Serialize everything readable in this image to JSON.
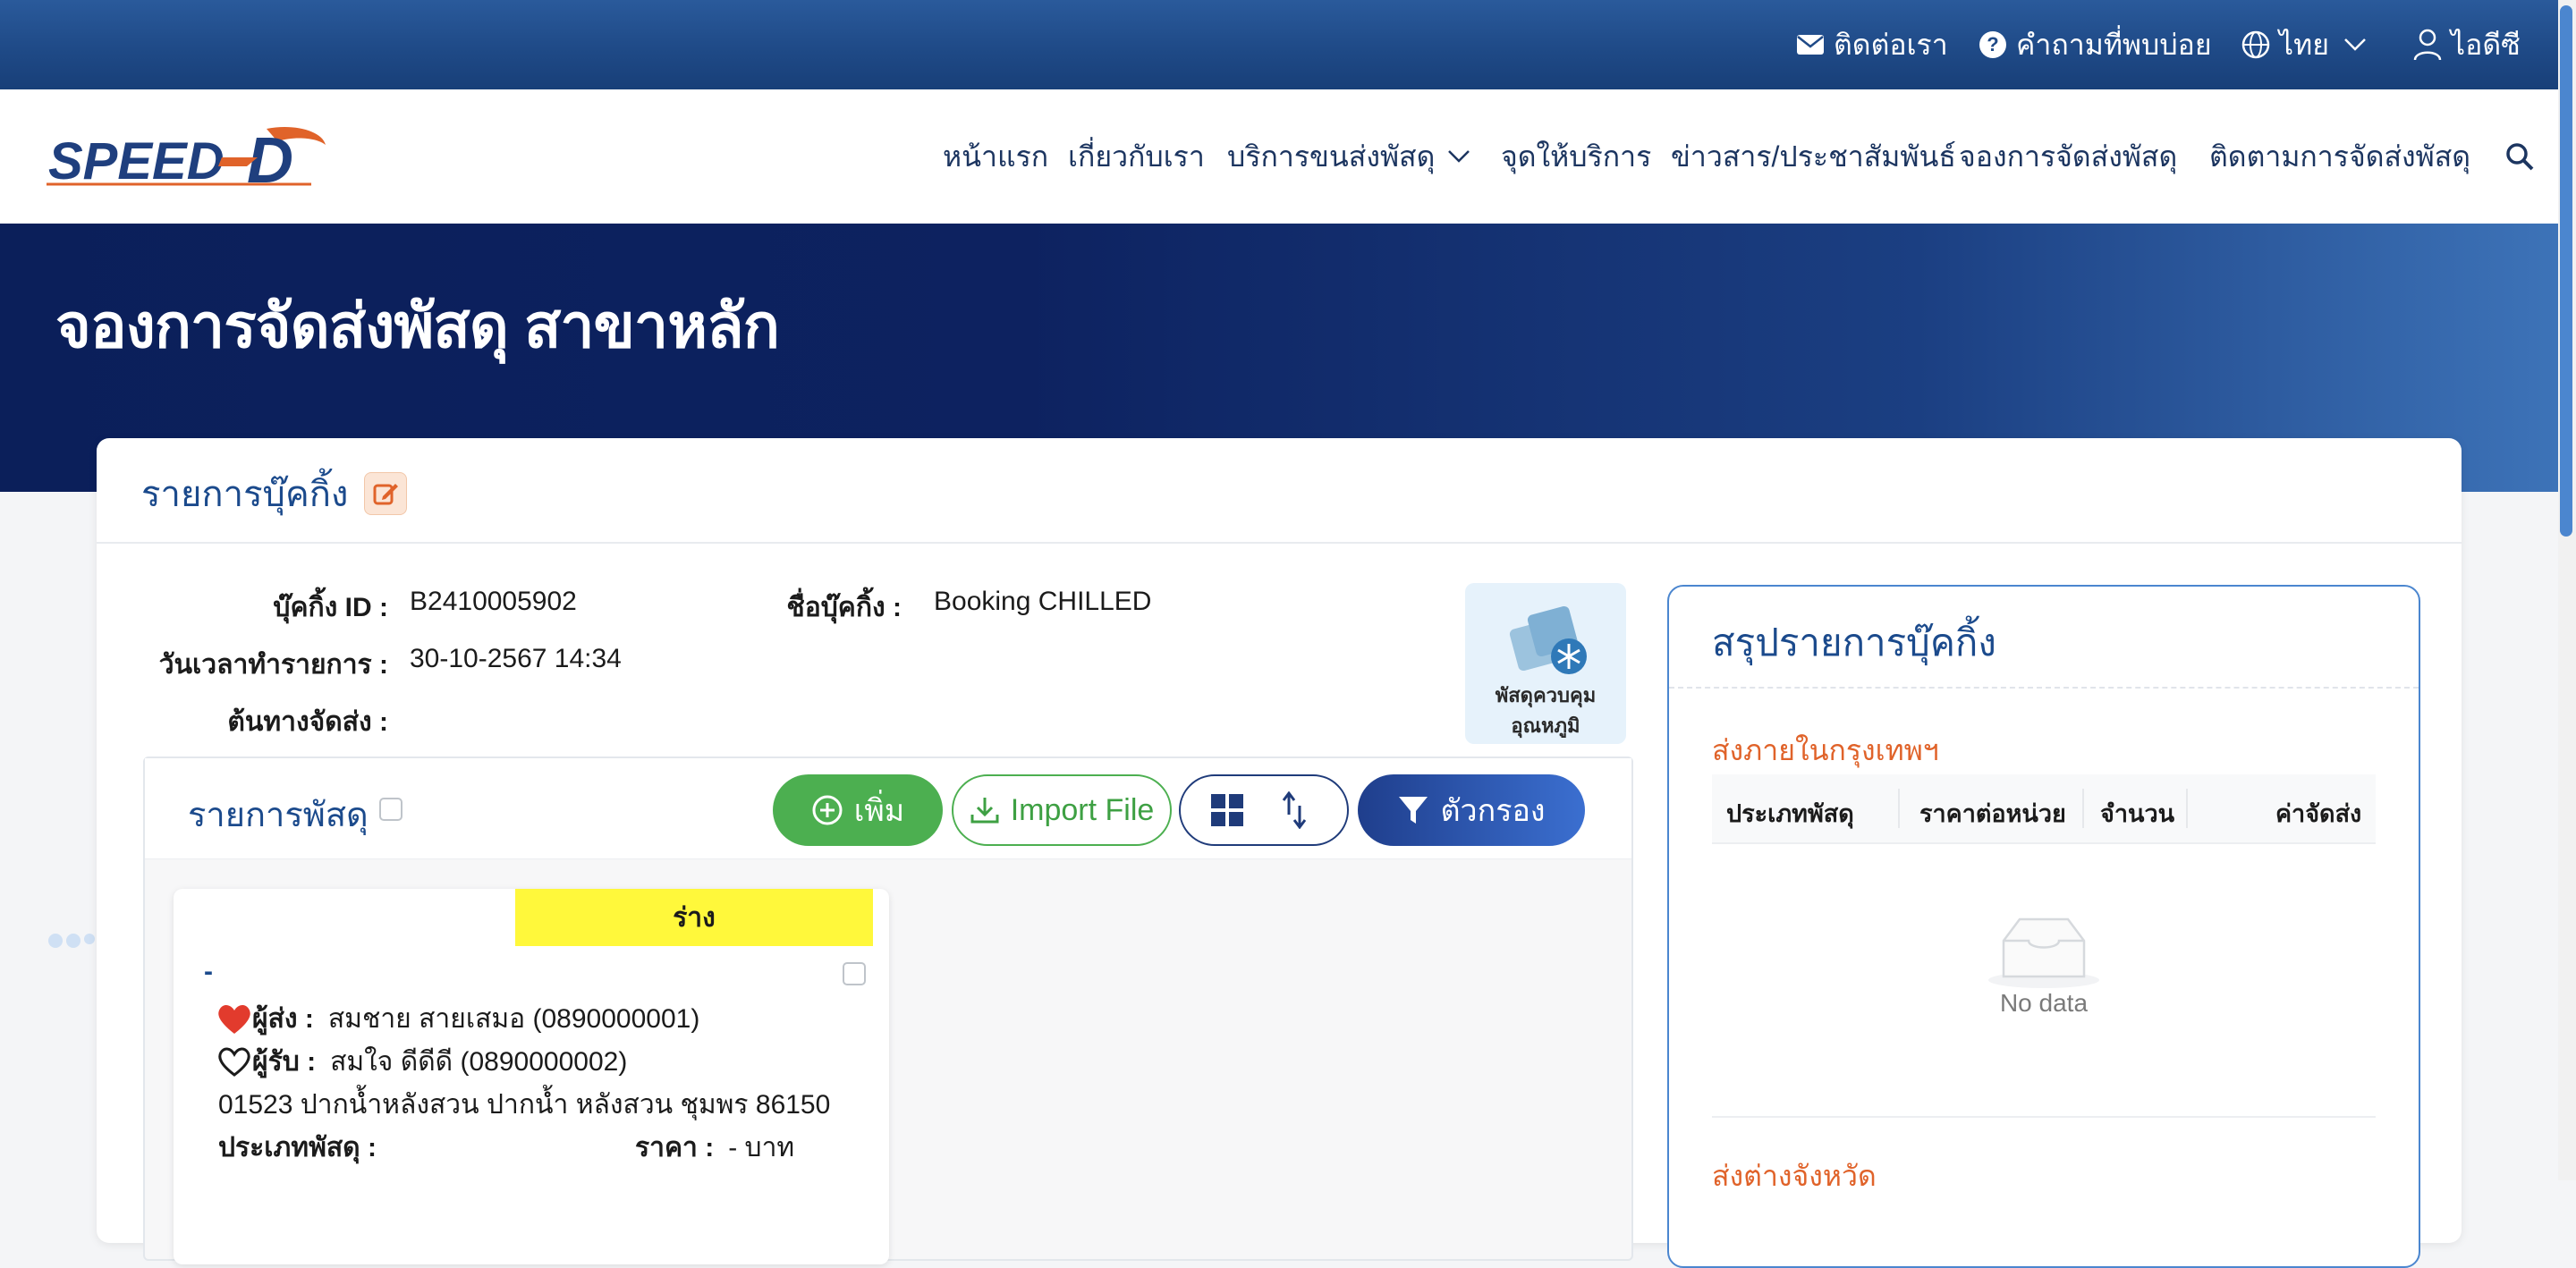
{
  "topbar": {
    "contact": "ติดต่อเรา",
    "faq": "คำถามที่พบบ่อย",
    "language": "ไทย",
    "user": "ไอดีซี"
  },
  "nav": {
    "logo_text": "SPEED-D",
    "items": [
      {
        "label": "หน้าแรก"
      },
      {
        "label": "เกี่ยวกับเรา"
      },
      {
        "label": "บริการขนส่งพัสดุ"
      },
      {
        "label": "จุดให้บริการ"
      },
      {
        "label": "ข่าวสาร/ประชาสัมพันธ์"
      },
      {
        "label": "จองการจัดส่งพัสดุ"
      },
      {
        "label": "ติดตามการจัดส่งพัสดุ"
      }
    ]
  },
  "hero": {
    "title": "จองการจัดส่งพัสดุ สาขาหลัก"
  },
  "booking": {
    "section_title": "รายการบุ๊คกิ้ง",
    "id_label": "บุ๊คกิ้ง ID :",
    "id_value": "B2410005902",
    "name_label": "ชื่อบุ๊คกิ้ง :",
    "name_value": "Booking CHILLED",
    "date_label": "วันเวลาทำรายการ :",
    "date_value": "30-10-2567 14:34",
    "origin_label": "ต้นทางจัดส่ง :",
    "origin_value": "",
    "chilled_line1": "พัสดุควบคุม",
    "chilled_line2": "อุณหภูมิ"
  },
  "parcels": {
    "title": "รายการพัสดุ",
    "add_label": "เพิ่ม",
    "import_label": "Import File",
    "filter_label": "ตัวกรอง",
    "card": {
      "status": "ร่าง",
      "code": "-",
      "sender_label": "ผู้ส่ง :",
      "sender_value": "สมชาย สายเสมอ  (0890000001)",
      "receiver_label": "ผู้รับ :",
      "receiver_value": "สมใจ ดีดีดี  (0890000002)",
      "address": "01523 ปากน้ำหลังสวน ปากน้ำ หลังสวน ชุมพร 86150",
      "type_label": "ประเภทพัสดุ :",
      "price_label": "ราคา :",
      "price_value": "- บาท"
    }
  },
  "summary": {
    "title": "สรุปรายการบุ๊คกิ้ง",
    "bangkok_label": "ส่งภายในกรุงเทพฯ",
    "columns": [
      "ประเภทพัสดุ",
      "ราคาต่อหน่วย",
      "จำนวน",
      "ค่าจัดส่ง"
    ],
    "no_data": "No data",
    "provincial_label": "ส่งต่างจังหวัด"
  },
  "colors": {
    "primary": "#1b4a8c",
    "accent_orange": "#e0632a",
    "green": "#4caf50",
    "draft_yellow": "#fff83b"
  }
}
